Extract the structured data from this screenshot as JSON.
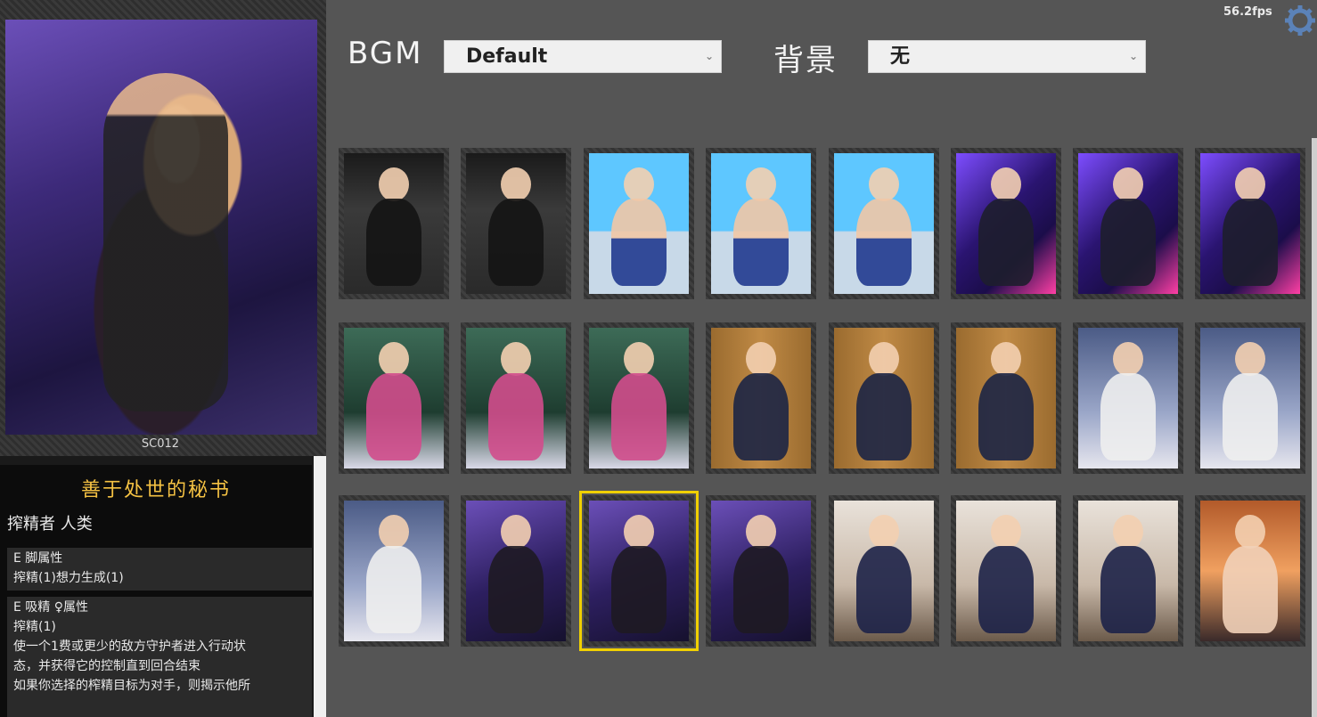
{
  "top": {
    "bgm_label": "BGM",
    "bgm_value": "Default",
    "background_label": "背景",
    "background_value": "无",
    "fps": "56.2fps"
  },
  "preview": {
    "code": "SC012",
    "name": "善于处世的秘书",
    "type": "搾精者 人类",
    "abilities": [
      {
        "title": "E 脚属性",
        "lines": [
          "搾精(1)想力生成(1)"
        ]
      },
      {
        "title": "E 吸精 ♀属性",
        "lines": [
          "搾精(1)",
          "使一个1费或更少的敌方守护者进入行动状",
          "态，并获得它的控制直到回合结束",
          "如果你选择的榨精目标为对手，则揭示他所"
        ]
      }
    ]
  },
  "cards": [
    {
      "art": "nun"
    },
    {
      "art": "nun"
    },
    {
      "art": "cheer"
    },
    {
      "art": "cheer"
    },
    {
      "art": "cheer"
    },
    {
      "art": "idol"
    },
    {
      "art": "idol"
    },
    {
      "art": "idol"
    },
    {
      "art": "pink"
    },
    {
      "art": "pink"
    },
    {
      "art": "pink"
    },
    {
      "art": "school"
    },
    {
      "art": "school"
    },
    {
      "art": "school"
    },
    {
      "art": "white"
    },
    {
      "art": "white"
    },
    {
      "art": "white"
    },
    {
      "art": "secretary"
    },
    {
      "art": "secretary",
      "selected": true
    },
    {
      "art": "secretary"
    },
    {
      "art": "wings"
    },
    {
      "art": "wings"
    },
    {
      "art": "wings"
    },
    {
      "art": "red"
    }
  ],
  "colors": {
    "title": "#f5c243",
    "selection": "#f0d000",
    "background": "#555555"
  },
  "icons": {
    "settings": "gear-icon",
    "dropdown": "chevron-down-icon"
  }
}
